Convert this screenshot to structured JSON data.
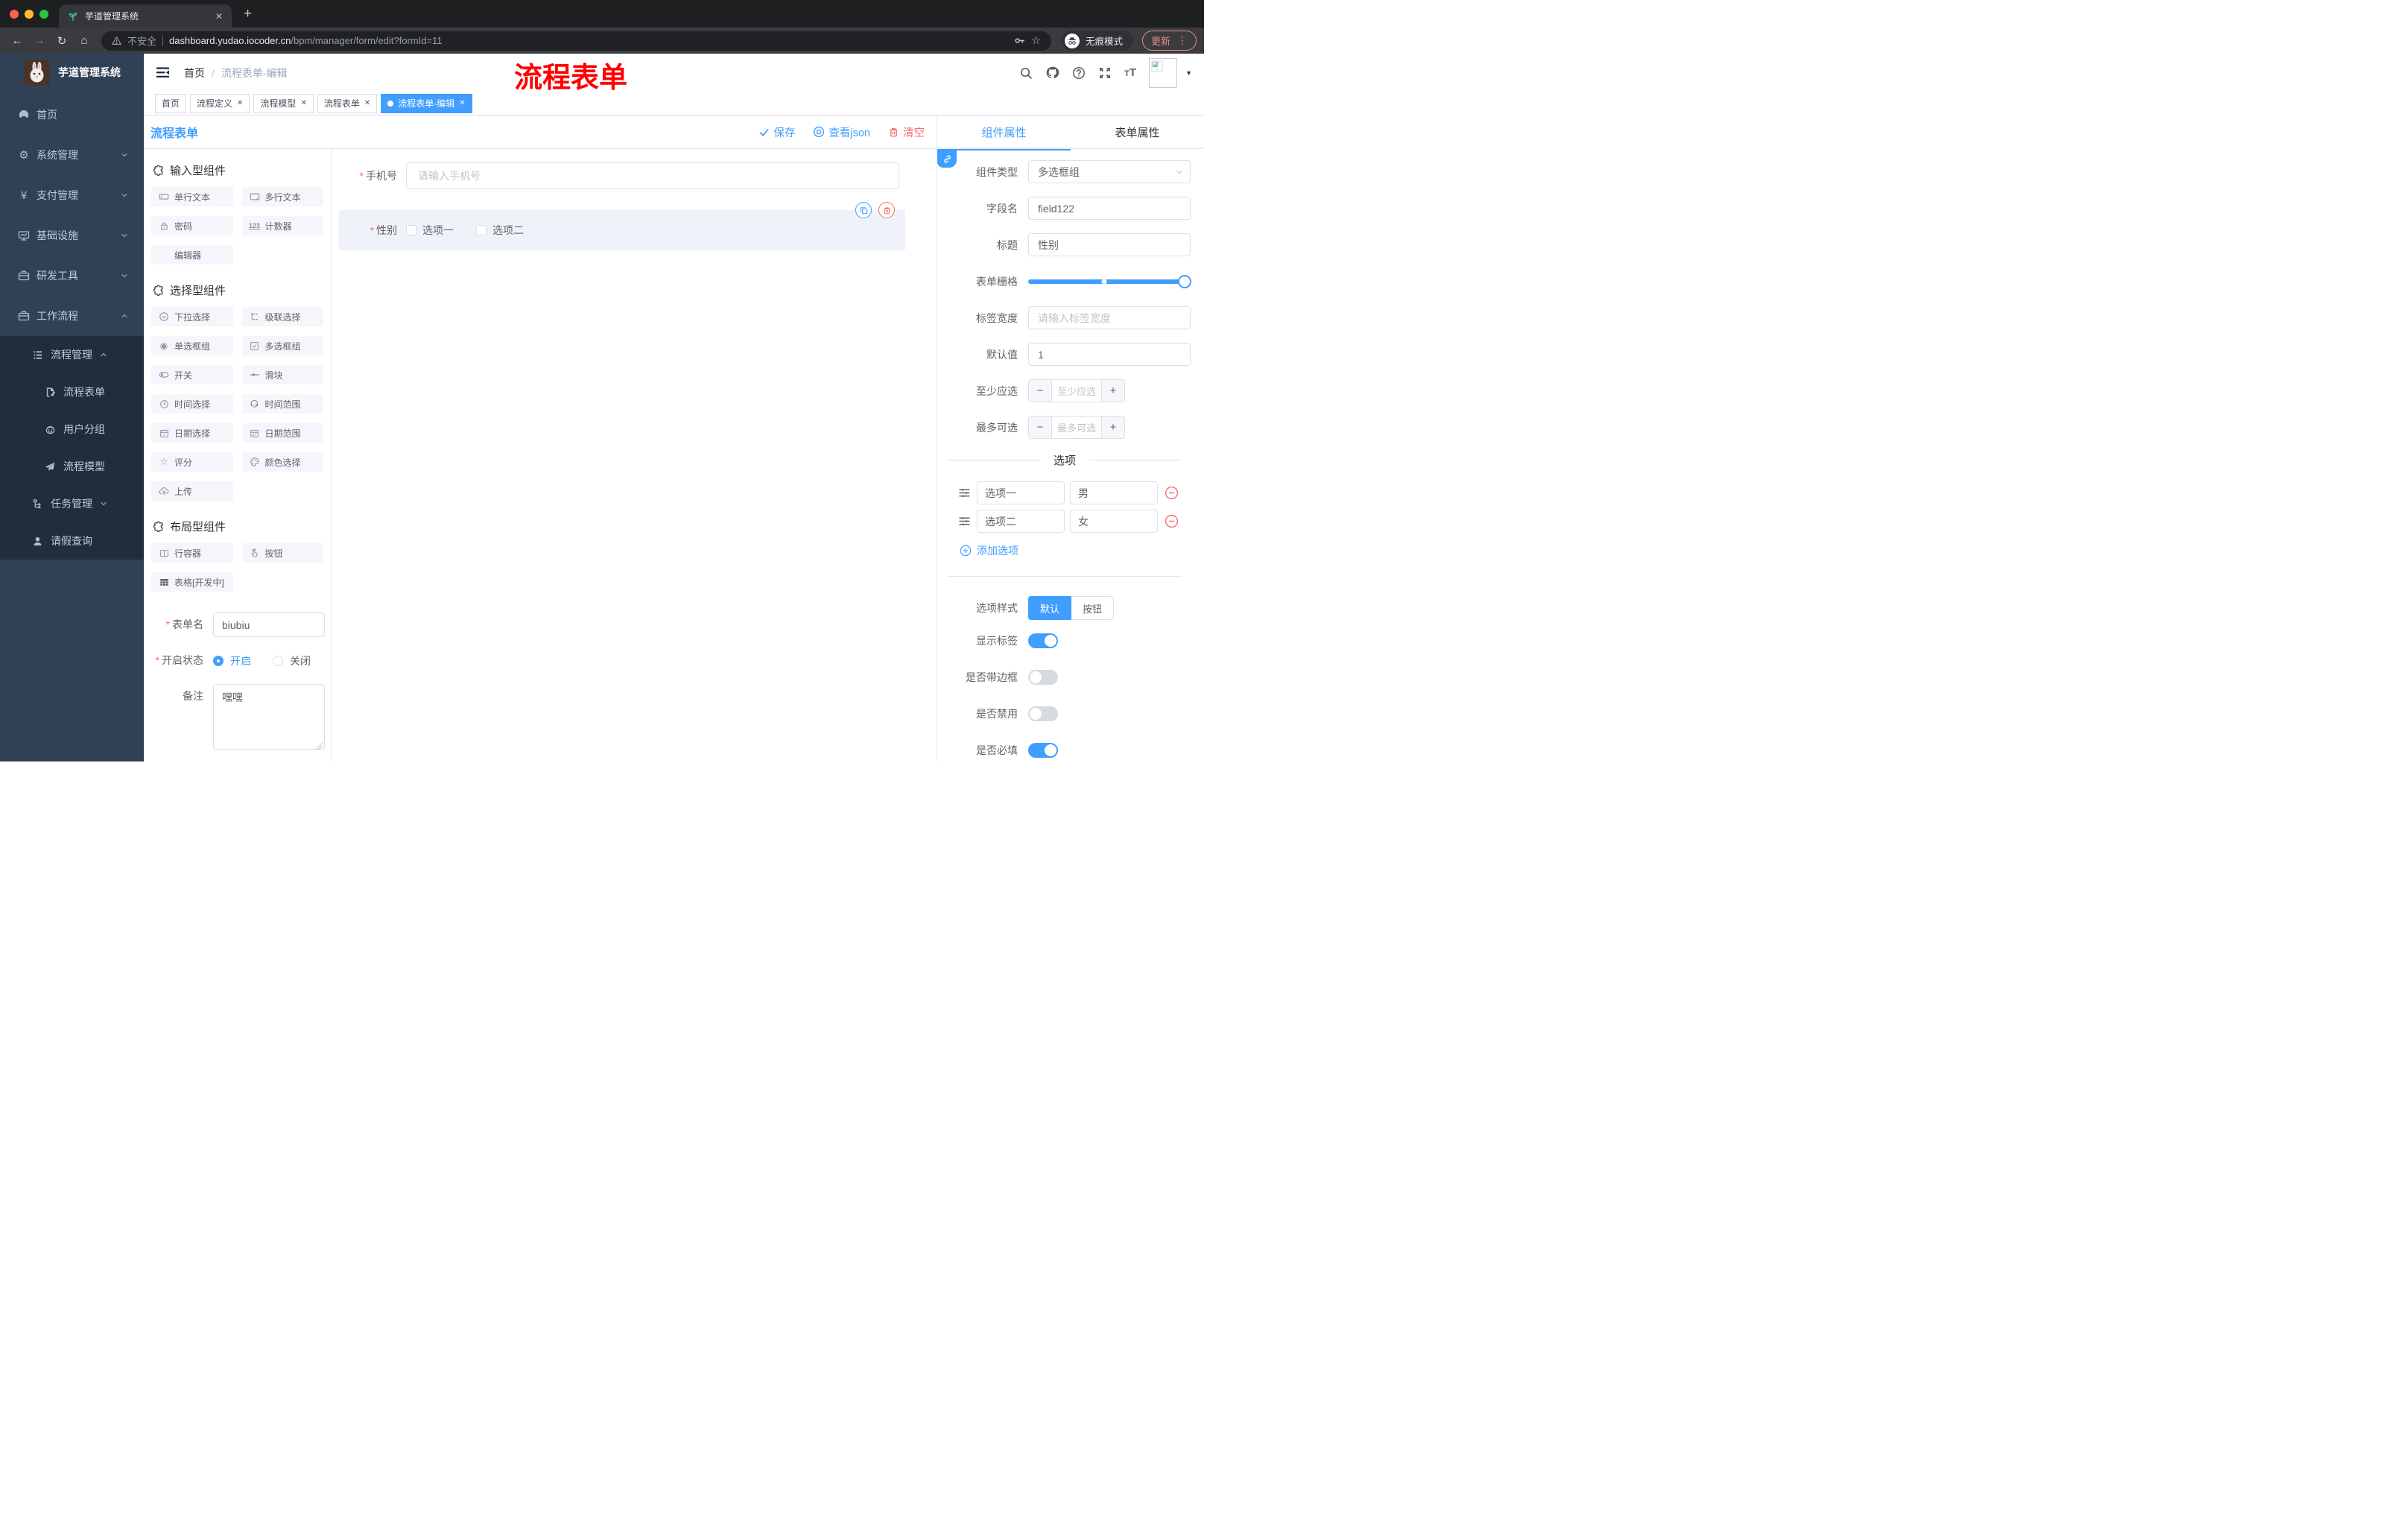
{
  "browser": {
    "tab_title": "芋道管理系统",
    "security_label": "不安全",
    "url_host": "dashboard.yudao.iocoder.cn",
    "url_path": "/bpm/manager/form/edit?formId=11",
    "incognito_label": "无痕模式",
    "update_label": "更新"
  },
  "icons": {
    "close_x": "✕",
    "plus": "+",
    "back": "←",
    "forward": "→",
    "reload": "↻",
    "home": "⌂",
    "star": "☆",
    "kebab": "⋮",
    "caret": "▼",
    "gear": "⚙",
    "yen": "¥",
    "asterisk": "*",
    "counter": "123",
    "radio_glyph": "◉",
    "star_outline": "☆",
    "t_small": "T",
    "t_big": "T",
    "slash": "/",
    "minus": "−",
    "plus_sm": "+"
  },
  "sidebar": {
    "logo_title": "芋道管理系统",
    "items": [
      {
        "label": "首页"
      },
      {
        "label": "系统管理"
      },
      {
        "label": "支付管理"
      },
      {
        "label": "基础设施"
      },
      {
        "label": "研发工具"
      },
      {
        "label": "工作流程"
      }
    ],
    "submenu": [
      {
        "label": "流程管理"
      },
      {
        "label": "流程表单"
      },
      {
        "label": "用户分组"
      },
      {
        "label": "流程模型"
      },
      {
        "label": "任务管理"
      },
      {
        "label": "请假查询"
      }
    ]
  },
  "header": {
    "breadcrumb_home": "首页",
    "breadcrumb_current": "流程表单-编辑",
    "annotation": "流程表单"
  },
  "tagbar": {
    "tags": [
      {
        "label": "首页"
      },
      {
        "label": "流程定义"
      },
      {
        "label": "流程模型"
      },
      {
        "label": "流程表单"
      },
      {
        "label": "流程表单-编辑"
      }
    ]
  },
  "toolbar": {
    "title": "流程表单",
    "save": "保存",
    "view_json": "查看json",
    "clear": "清空"
  },
  "palette": {
    "sections": [
      {
        "title": "输入型组件",
        "items": [
          {
            "label": "单行文本"
          },
          {
            "label": "多行文本"
          },
          {
            "label": "密码"
          },
          {
            "label": "计数器"
          },
          {
            "label": "编辑器"
          }
        ]
      },
      {
        "title": "选择型组件",
        "items": [
          {
            "label": "下拉选择"
          },
          {
            "label": "级联选择"
          },
          {
            "label": "单选框组"
          },
          {
            "label": "多选框组"
          },
          {
            "label": "开关"
          },
          {
            "label": "滑块"
          },
          {
            "label": "时间选择"
          },
          {
            "label": "时间范围"
          },
          {
            "label": "日期选择"
          },
          {
            "label": "日期范围"
          },
          {
            "label": "评分"
          },
          {
            "label": "颜色选择"
          },
          {
            "label": "上传"
          }
        ]
      },
      {
        "title": "布局型组件",
        "items": [
          {
            "label": "行容器"
          },
          {
            "label": "按钮"
          },
          {
            "label": "表格[开发中]"
          }
        ]
      }
    ]
  },
  "meta_form": {
    "name_label": "表单名",
    "name_value": "biubiu",
    "status_label": "开启状态",
    "status_on": "开启",
    "status_off": "关闭",
    "remark_label": "备注",
    "remark_value": "嘿嘿"
  },
  "canvas": {
    "phone_label": "手机号",
    "phone_placeholder": "请输入手机号",
    "gender_label": "性别",
    "gender_opt1": "选项一",
    "gender_opt2": "选项二"
  },
  "panel": {
    "tab_component": "组件属性",
    "tab_form": "表单属性",
    "type_label": "组件类型",
    "type_value": "多选框组",
    "field_label": "字段名",
    "field_value": "field122",
    "title_label": "标题",
    "title_value": "性别",
    "grid_label": "表单栅格",
    "width_label": "标签宽度",
    "width_placeholder": "请输入标签宽度",
    "default_label": "默认值",
    "default_value": "1",
    "min_label": "至少应选",
    "min_placeholder": "至少应选",
    "max_label": "最多可选",
    "max_placeholder": "最多可选",
    "options_divider": "选项",
    "options": [
      {
        "label": "选项一",
        "value": "男"
      },
      {
        "label": "选项二",
        "value": "女"
      }
    ],
    "add_option": "添加选项",
    "style_label": "选项样式",
    "style_default": "默认",
    "style_button": "按钮",
    "switches": [
      {
        "label": "显示标签",
        "on": true
      },
      {
        "label": "是否带边框",
        "on": false
      },
      {
        "label": "是否禁用",
        "on": false
      },
      {
        "label": "是否必填",
        "on": true
      }
    ]
  },
  "colors": {
    "accent": "#409EFF",
    "danger": "#F56C6C",
    "annotation_red": "#FF0000",
    "sidebar_bg": "#304156",
    "submenu_bg": "#1F2D3D",
    "chip_bg": "#F4F6FC",
    "selected_block_bg": "#F0F2FA"
  }
}
